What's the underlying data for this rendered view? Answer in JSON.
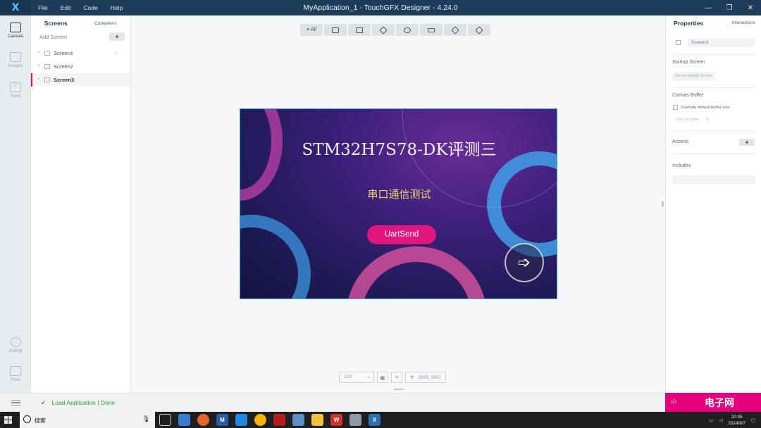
{
  "titlebar": {
    "logo": "X",
    "menu": [
      "File",
      "Edit",
      "Code",
      "Help"
    ],
    "title": "MyApplication_1 - TouchGFX Designer - 4.24.0",
    "controls": [
      "—",
      "❐",
      "✕"
    ]
  },
  "rail": {
    "items": [
      {
        "label": "Canvas",
        "icon": "canvas-icon",
        "active": true
      },
      {
        "label": "Images",
        "icon": "images-icon"
      },
      {
        "label": "Texts",
        "icon": "texts-icon"
      },
      {
        "label": "Config",
        "icon": "gear-icon"
      },
      {
        "label": "Files",
        "icon": "folder-icon"
      }
    ]
  },
  "screens_panel": {
    "tab_screens": "Screens",
    "tab_containers": "Containers",
    "add_screen": "Add Screen",
    "add_symbol": "+",
    "screens": [
      "Screen1",
      "Screen2",
      "Screen3"
    ],
    "selected": "Screen3"
  },
  "toolbar": {
    "all_label": "All",
    "icons": [
      "cursor-icon",
      "image-icon",
      "layers-icon",
      "shapes-icon",
      "text-box-icon",
      "cube-icon",
      "stack-icon"
    ]
  },
  "screen_content": {
    "title": "STM32H7S78-DK评测三",
    "subtitle": "串口通信测试",
    "button_label": "UartSend",
    "nav_symbol": "➩"
  },
  "bottom": {
    "zoom": "100",
    "coords": "(688, 584)"
  },
  "properties": {
    "tab_properties": "Properties",
    "tab_interactions": "Interactions",
    "name_value": "Screen3",
    "startup_title": "Startup Screen",
    "startup_btn": "Set as startup Screen",
    "canvas_buffer_title": "Canvas Buffer",
    "override_label": "Override default buffer size",
    "size_label": "Size in bytes",
    "size_value": "0",
    "actions_title": "Actions",
    "actions_plus": "+",
    "includes_title": "Includes"
  },
  "status": {
    "check": "✔",
    "message": "Load Application  |  Done",
    "badge_left": "‹/›",
    "badge_right": "电子网"
  },
  "taskbar": {
    "search_text": "搜索",
    "time": "20:05",
    "date": "2024/9/7",
    "tray_icons": [
      "network-icon",
      "volume-icon",
      "notification-icon"
    ]
  }
}
